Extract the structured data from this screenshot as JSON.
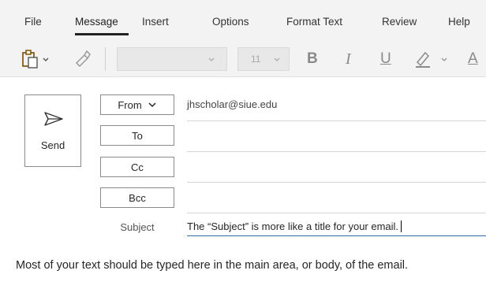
{
  "menu": {
    "tabs": [
      {
        "label": "File"
      },
      {
        "label": "Message"
      },
      {
        "label": "Insert"
      },
      {
        "label": "Options"
      },
      {
        "label": "Format Text"
      },
      {
        "label": "Review"
      },
      {
        "label": "Help"
      }
    ],
    "active_tab": "Message"
  },
  "ribbon": {
    "font_size_value": "11",
    "bold_glyph": "B",
    "italic_glyph": "I",
    "underline_glyph": "U",
    "font_color_glyph": "A",
    "icons": [
      "paste-icon",
      "format-painter-icon",
      "highlighter-icon"
    ]
  },
  "compose": {
    "send_label": "Send",
    "from_label": "From",
    "from_value": "jhscholar@siue.edu",
    "to_label": "To",
    "cc_label": "Cc",
    "bcc_label": "Bcc",
    "subject_label": "Subject",
    "subject_value": "The “Subject” is more like a title for your email.",
    "body_text": "Most of your text should be typed here in the main area, or body, of the email."
  },
  "colors": {
    "accent_line": "#2b6cb0",
    "ribbon_bg": "#f3f3f3"
  }
}
